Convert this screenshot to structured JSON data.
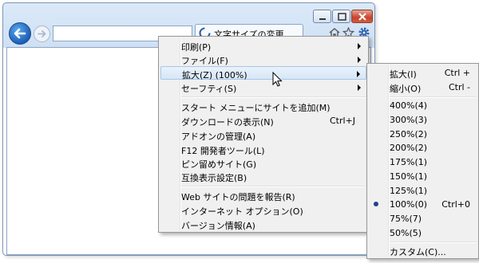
{
  "tab": {
    "title": "文字サイズの変更"
  },
  "main_menu": {
    "items": [
      {
        "label": "印刷(P)",
        "shortcut": "",
        "submenu": true
      },
      {
        "label": "ファイル(F)",
        "shortcut": "",
        "submenu": true
      },
      {
        "label": "拡大(Z) (100%)",
        "shortcut": "",
        "submenu": true,
        "highlighted": true
      },
      {
        "label": "セーフティ(S)",
        "shortcut": "",
        "submenu": true
      },
      {
        "label": "スタート メニューにサイトを追加(M)",
        "shortcut": ""
      },
      {
        "label": "ダウンロードの表示(N)",
        "shortcut": "Ctrl+J"
      },
      {
        "label": "アドオンの管理(A)",
        "shortcut": ""
      },
      {
        "label": "F12 開発者ツール(L)",
        "shortcut": ""
      },
      {
        "label": "ピン留めサイト(G)",
        "shortcut": ""
      },
      {
        "label": "互換表示設定(B)",
        "shortcut": ""
      },
      {
        "label": "Web サイトの問題を報告(R)",
        "shortcut": ""
      },
      {
        "label": "インターネット オプション(O)",
        "shortcut": ""
      },
      {
        "label": "バージョン情報(A)",
        "shortcut": ""
      }
    ]
  },
  "zoom_menu": {
    "items": [
      {
        "label": "拡大(I)",
        "shortcut": "Ctrl +"
      },
      {
        "label": "縮小(O)",
        "shortcut": "Ctrl -"
      },
      {
        "label": "400%(4)",
        "shortcut": ""
      },
      {
        "label": "300%(3)",
        "shortcut": ""
      },
      {
        "label": "250%(2)",
        "shortcut": ""
      },
      {
        "label": "200%(2)",
        "shortcut": ""
      },
      {
        "label": "175%(1)",
        "shortcut": ""
      },
      {
        "label": "150%(1)",
        "shortcut": ""
      },
      {
        "label": "125%(1)",
        "shortcut": ""
      },
      {
        "label": "100%(0)",
        "shortcut": "Ctrl+0",
        "selected": true
      },
      {
        "label": "75%(7)",
        "shortcut": ""
      },
      {
        "label": "50%(5)",
        "shortcut": ""
      },
      {
        "label": "カスタム(C)...",
        "shortcut": ""
      }
    ]
  },
  "icons": {
    "back": "back-arrow-icon",
    "forward": "forward-arrow-icon",
    "home": "home-icon",
    "favorites": "star-icon",
    "tools": "gear-icon",
    "tab": "ie-loading-icon"
  },
  "colors": {
    "accent": "#1b5fb5",
    "menu_bg": "#f0f0f0",
    "highlight": "#d7e6f7",
    "close": "#c8442c"
  }
}
